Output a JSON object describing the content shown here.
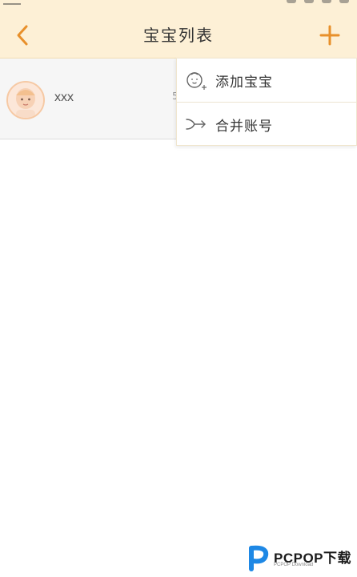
{
  "header": {
    "title": "宝宝列表",
    "back_icon": "chevron-left-icon",
    "add_icon": "plus-icon",
    "accent_color": "#e8902b",
    "background_color": "#fdf0d6"
  },
  "baby_list": {
    "items": [
      {
        "name": "xxx",
        "avatar_icon": "baby-avatar-icon",
        "trailing_partial": "5"
      }
    ]
  },
  "dropdown_menu": {
    "items": [
      {
        "label": "添加宝宝",
        "icon": "add-baby-icon"
      },
      {
        "label": "合并账号",
        "icon": "merge-account-icon"
      }
    ]
  },
  "watermark": {
    "text": "PCPOP下载",
    "subtext": "PCPOP Download"
  }
}
